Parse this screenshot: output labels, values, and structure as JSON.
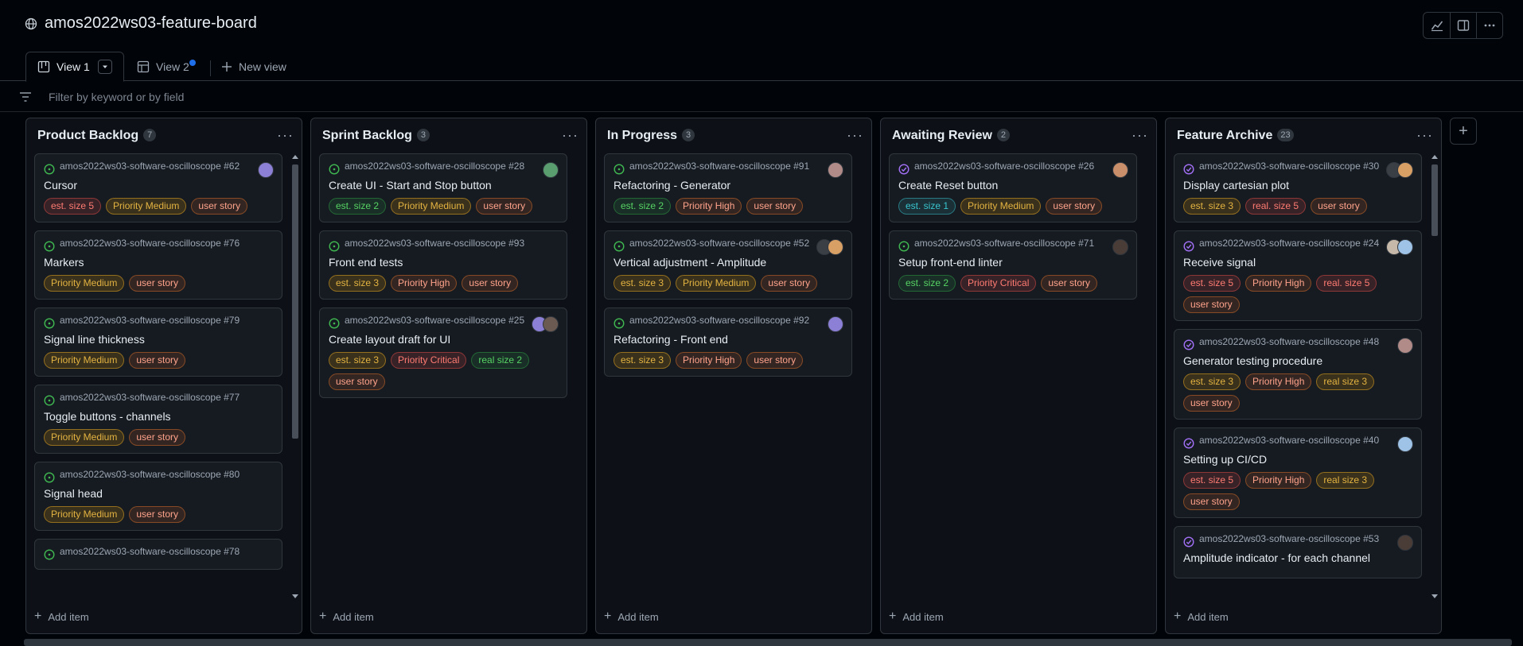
{
  "project": {
    "title": "amos2022ws03-feature-board"
  },
  "toolbar": {
    "icons": [
      "insights-icon",
      "side-panel-icon",
      "more-icon"
    ]
  },
  "tabs": [
    {
      "label": "View 1",
      "icon": "board-icon"
    },
    {
      "label": "View 2",
      "icon": "table-icon"
    },
    {
      "label": "New view",
      "icon": "plus-icon"
    }
  ],
  "filter": {
    "placeholder": "Filter by keyword or by field"
  },
  "add_item_label": "Add item",
  "colors": {
    "red": {
      "fg": "#ff7b72",
      "bg": "rgba(248,81,73,0.15)",
      "bd": "rgba(248,81,73,0.45)"
    },
    "yellow": {
      "fg": "#e3b341",
      "bg": "rgba(187,128,9,0.22)",
      "bd": "rgba(210,153,34,0.6)"
    },
    "orange": {
      "fg": "#ffa28b",
      "bg": "rgba(219,109,40,0.15)",
      "bd": "rgba(219,109,40,0.5)"
    },
    "green": {
      "fg": "#56d364",
      "bg": "rgba(46,160,67,0.15)",
      "bd": "rgba(46,160,67,0.5)"
    },
    "blue": {
      "fg": "#39c5cf",
      "bg": "rgba(57,197,207,0.12)",
      "bd": "rgba(57,197,207,0.5)"
    }
  },
  "columns": [
    {
      "name": "Product Backlog",
      "count": "7",
      "scroll": {
        "thumb_fraction": 0.65,
        "offset_fraction": 0.0
      },
      "cards": [
        {
          "repo": "amos2022ws03-software-oscilloscope",
          "num": "#62",
          "title": "Cursor",
          "status": "open",
          "avatars": [
            "#8b7fd6"
          ],
          "labels": [
            {
              "t": "est. size 5",
              "c": "red"
            },
            {
              "t": "Priority Medium",
              "c": "yellow"
            },
            {
              "t": "user story",
              "c": "orange"
            }
          ]
        },
        {
          "repo": "amos2022ws03-software-oscilloscope",
          "num": "#76",
          "title": "Markers",
          "status": "open",
          "avatars": [],
          "labels": [
            {
              "t": "Priority Medium",
              "c": "yellow"
            },
            {
              "t": "user story",
              "c": "orange"
            }
          ]
        },
        {
          "repo": "amos2022ws03-software-oscilloscope",
          "num": "#79",
          "title": "Signal line thickness",
          "status": "open",
          "avatars": [],
          "labels": [
            {
              "t": "Priority Medium",
              "c": "yellow"
            },
            {
              "t": "user story",
              "c": "orange"
            }
          ]
        },
        {
          "repo": "amos2022ws03-software-oscilloscope",
          "num": "#77",
          "title": "Toggle buttons - channels",
          "status": "open",
          "avatars": [],
          "labels": [
            {
              "t": "Priority Medium",
              "c": "yellow"
            },
            {
              "t": "user story",
              "c": "orange"
            }
          ]
        },
        {
          "repo": "amos2022ws03-software-oscilloscope",
          "num": "#80",
          "title": "Signal head",
          "status": "open",
          "avatars": [],
          "labels": [
            {
              "t": "Priority Medium",
              "c": "yellow"
            },
            {
              "t": "user story",
              "c": "orange"
            }
          ]
        },
        {
          "repo": "amos2022ws03-software-oscilloscope",
          "num": "#78",
          "title": "",
          "status": "open",
          "avatars": [],
          "labels": []
        }
      ]
    },
    {
      "name": "Sprint Backlog",
      "count": "3",
      "cards": [
        {
          "repo": "amos2022ws03-software-oscilloscope",
          "num": "#28",
          "title": "Create UI - Start and Stop button",
          "status": "open",
          "avatars": [
            "#5a9e6f"
          ],
          "labels": [
            {
              "t": "est. size 2",
              "c": "green"
            },
            {
              "t": "Priority Medium",
              "c": "yellow"
            },
            {
              "t": "user story",
              "c": "orange"
            }
          ]
        },
        {
          "repo": "amos2022ws03-software-oscilloscope",
          "num": "#93",
          "title": "Front end tests",
          "status": "open",
          "avatars": [],
          "labels": [
            {
              "t": "est. size 3",
              "c": "yellow"
            },
            {
              "t": "Priority High",
              "c": "orange"
            },
            {
              "t": "user story",
              "c": "orange"
            }
          ]
        },
        {
          "repo": "amos2022ws03-software-oscilloscope",
          "num": "#25",
          "title": "Create layout draft for UI",
          "status": "open",
          "avatars": [
            "#8b7fd6",
            "#6b5a52"
          ],
          "labels": [
            {
              "t": "est. size 3",
              "c": "yellow"
            },
            {
              "t": "Priority Critical",
              "c": "red"
            },
            {
              "t": "real size 2",
              "c": "green"
            },
            {
              "t": "user story",
              "c": "orange"
            }
          ]
        }
      ]
    },
    {
      "name": "In Progress",
      "count": "3",
      "cards": [
        {
          "repo": "amos2022ws03-software-oscilloscope",
          "num": "#91",
          "title": "Refactoring - Generator",
          "status": "open",
          "avatars": [
            "#b08b88"
          ],
          "labels": [
            {
              "t": "est. size 2",
              "c": "green"
            },
            {
              "t": "Priority High",
              "c": "orange"
            },
            {
              "t": "user story",
              "c": "orange"
            }
          ]
        },
        {
          "repo": "amos2022ws03-software-oscilloscope",
          "num": "#52",
          "title": "Vertical adjustment - Amplitude",
          "status": "open",
          "avatars": [
            "#3a3f46",
            "#d9a066"
          ],
          "labels": [
            {
              "t": "est. size 3",
              "c": "yellow"
            },
            {
              "t": "Priority Medium",
              "c": "yellow"
            },
            {
              "t": "user story",
              "c": "orange"
            }
          ]
        },
        {
          "repo": "amos2022ws03-software-oscilloscope",
          "num": "#92",
          "title": "Refactoring - Front end",
          "status": "open",
          "avatars": [
            "#8b7fd6"
          ],
          "labels": [
            {
              "t": "est. size 3",
              "c": "yellow"
            },
            {
              "t": "Priority High",
              "c": "orange"
            },
            {
              "t": "user story",
              "c": "orange"
            }
          ]
        }
      ]
    },
    {
      "name": "Awaiting Review",
      "count": "2",
      "cards": [
        {
          "repo": "amos2022ws03-software-oscilloscope",
          "num": "#26",
          "title": "Create Reset button",
          "status": "closed",
          "avatars": [
            "#c98e6a"
          ],
          "labels": [
            {
              "t": "est. size 1",
              "c": "blue"
            },
            {
              "t": "Priority Medium",
              "c": "yellow"
            },
            {
              "t": "user story",
              "c": "orange"
            }
          ]
        },
        {
          "repo": "amos2022ws03-software-oscilloscope",
          "num": "#71",
          "title": "Setup front-end linter",
          "status": "open",
          "avatars": [
            "#4a3c36"
          ],
          "labels": [
            {
              "t": "est. size 2",
              "c": "green"
            },
            {
              "t": "Priority Critical",
              "c": "red"
            },
            {
              "t": "user story",
              "c": "orange"
            }
          ]
        }
      ]
    },
    {
      "name": "Feature Archive",
      "count": "23",
      "scroll": {
        "thumb_fraction": 0.17,
        "offset_fraction": 0.0
      },
      "cards": [
        {
          "repo": "amos2022ws03-software-oscilloscope",
          "num": "#30",
          "title": "Display cartesian plot",
          "status": "closed",
          "avatars": [
            "#3a3f46",
            "#d9a066"
          ],
          "labels": [
            {
              "t": "est. size 3",
              "c": "yellow"
            },
            {
              "t": "real. size 5",
              "c": "red"
            },
            {
              "t": "user story",
              "c": "orange"
            }
          ]
        },
        {
          "repo": "amos2022ws03-software-oscilloscope",
          "num": "#24",
          "title": "Receive signal",
          "status": "closed",
          "avatars": [
            "#c7b9a9",
            "#9ec3e6"
          ],
          "labels": [
            {
              "t": "est. size 5",
              "c": "red"
            },
            {
              "t": "Priority High",
              "c": "orange"
            },
            {
              "t": "real. size 5",
              "c": "red"
            },
            {
              "t": "user story",
              "c": "orange"
            }
          ]
        },
        {
          "repo": "amos2022ws03-software-oscilloscope",
          "num": "#48",
          "title": "Generator testing procedure",
          "status": "closed",
          "avatars": [
            "#b08b88"
          ],
          "labels": [
            {
              "t": "est. size 3",
              "c": "yellow"
            },
            {
              "t": "Priority High",
              "c": "orange"
            },
            {
              "t": "real size 3",
              "c": "yellow"
            },
            {
              "t": "user story",
              "c": "orange"
            }
          ]
        },
        {
          "repo": "amos2022ws03-software-oscilloscope",
          "num": "#40",
          "title": "Setting up CI/CD",
          "status": "closed",
          "avatars": [
            "#9ec3e6"
          ],
          "labels": [
            {
              "t": "est. size 5",
              "c": "red"
            },
            {
              "t": "Priority High",
              "c": "orange"
            },
            {
              "t": "real size 3",
              "c": "yellow"
            },
            {
              "t": "user story",
              "c": "orange"
            }
          ]
        },
        {
          "repo": "amos2022ws03-software-oscilloscope",
          "num": "#53",
          "title": "Amplitude indicator - for each channel",
          "status": "closed",
          "avatars": [
            "#4a3c36"
          ],
          "labels": []
        }
      ]
    }
  ]
}
